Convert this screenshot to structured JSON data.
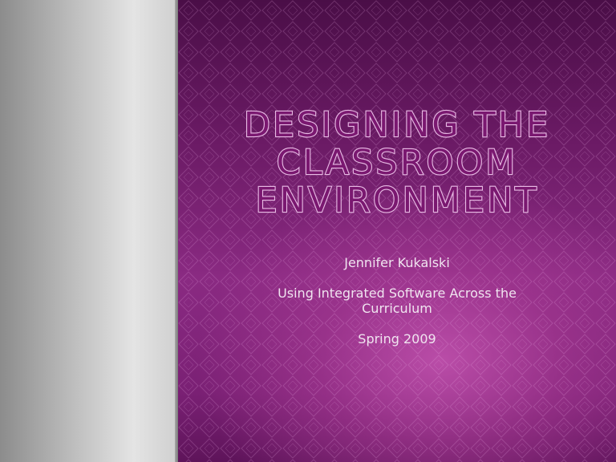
{
  "slide": {
    "title_lines": [
      "Designing the",
      "Classroom",
      "Environment"
    ],
    "author": "Jennifer Kukalski",
    "course": "Using Integrated Software Across the Curriculum",
    "term": "Spring 2009"
  },
  "colors": {
    "left_panel": "#bcbcbc",
    "background_dark": "#4a0e47",
    "background_mid": "#8a2a82",
    "title_fill": "#7a1870",
    "title_outline": "#e6b8e2",
    "subtitle_text": "#f0e4f0"
  }
}
